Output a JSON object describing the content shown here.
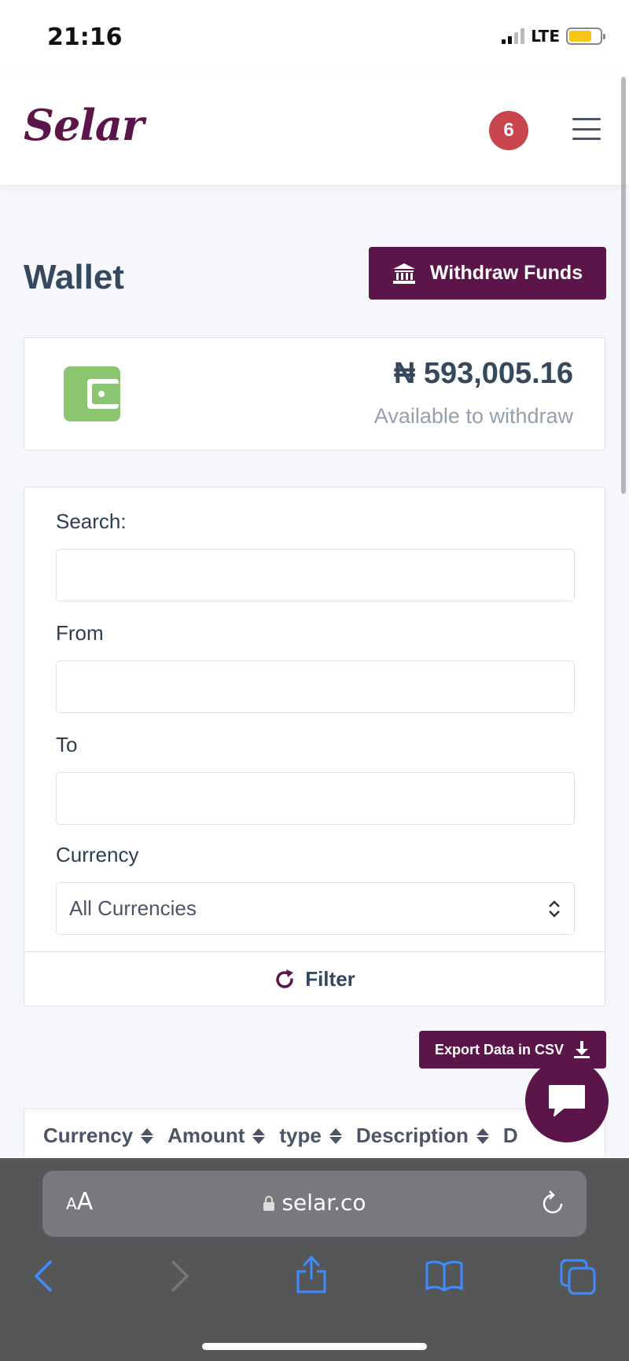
{
  "status_bar": {
    "time": "21:16",
    "network": "LTE"
  },
  "header": {
    "logo": "Selar",
    "notification_count": "6"
  },
  "page": {
    "title": "Wallet",
    "withdraw_label": "Withdraw Funds"
  },
  "balance": {
    "amount": "₦ 593,005.16",
    "label": "Available to withdraw"
  },
  "filters": {
    "search_label": "Search:",
    "search_value": "",
    "from_label": "From",
    "from_value": "",
    "to_label": "To",
    "to_value": "",
    "currency_label": "Currency",
    "currency_selected": "All Currencies",
    "filter_label": "Filter"
  },
  "export": {
    "label": "Export Data in CSV"
  },
  "table": {
    "columns": [
      "Currency",
      "Amount",
      "type",
      "Description",
      "D"
    ]
  },
  "browser": {
    "aa_small": "A",
    "aa_large": "A",
    "url": "selar.co"
  },
  "colors": {
    "brand": "#5c1548",
    "badge": "#c9454d",
    "wallet": "#8cc56f"
  }
}
